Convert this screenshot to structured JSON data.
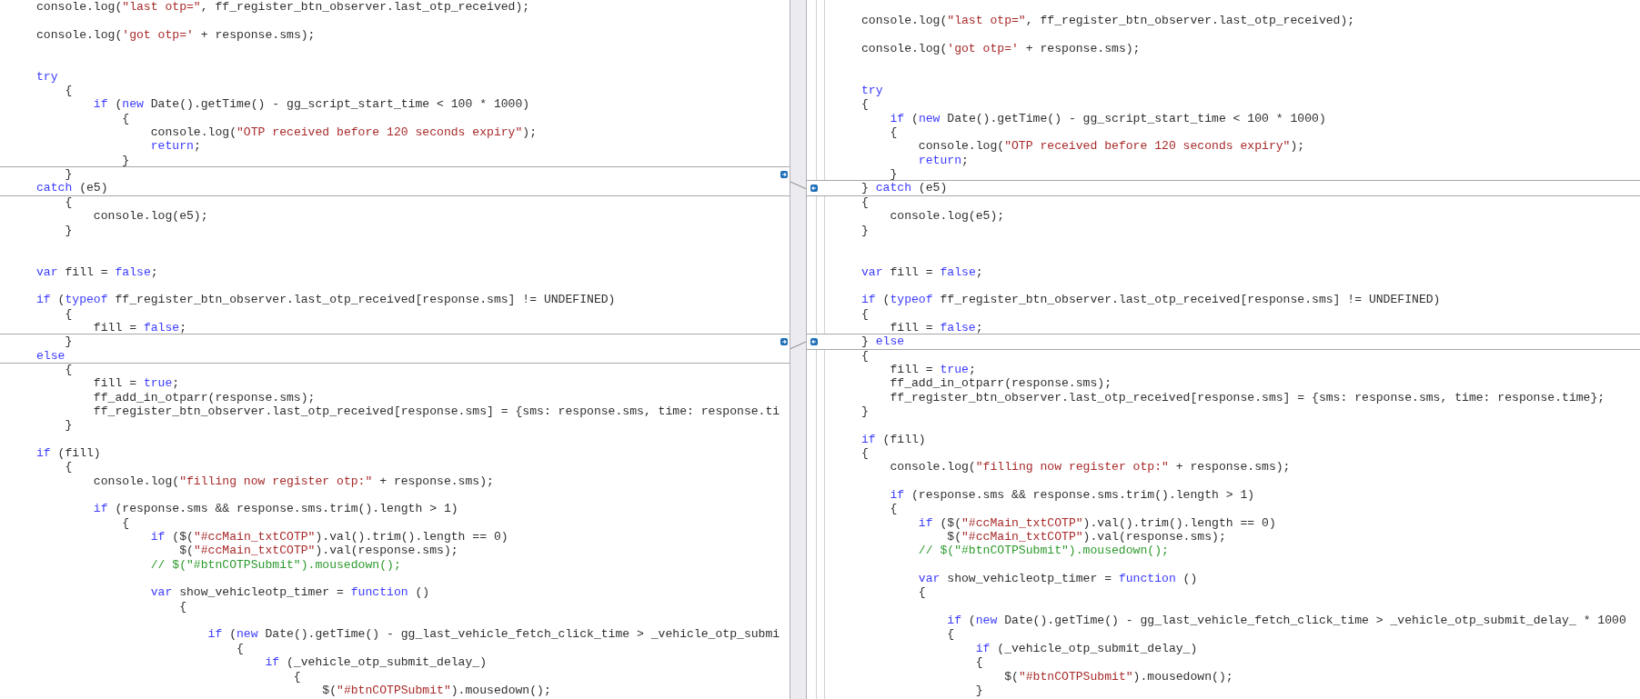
{
  "left_pane": {
    "lines": [
      {
        "kind": "code",
        "segments": [
          {
            "kind": "plain",
            "text": "console.log("
          },
          {
            "kind": "string",
            "text": "\"last otp=\""
          },
          {
            "kind": "plain",
            "text": ", ff_register_btn_observer.last_otp_received);"
          }
        ]
      },
      {
        "kind": "blank"
      },
      {
        "kind": "code",
        "segments": [
          {
            "kind": "plain",
            "text": "console.log("
          },
          {
            "kind": "string",
            "text": "'got otp='"
          },
          {
            "kind": "plain",
            "text": " + response.sms);"
          }
        ]
      },
      {
        "kind": "blank"
      },
      {
        "kind": "blank"
      },
      {
        "kind": "code",
        "segments": [
          {
            "kind": "keyword",
            "text": "try"
          }
        ]
      },
      {
        "kind": "code",
        "segments": [
          {
            "kind": "plain",
            "text": "    {"
          }
        ]
      },
      {
        "kind": "code",
        "segments": [
          {
            "kind": "keyword",
            "text": "        if"
          },
          {
            "kind": "plain",
            "text": " ("
          },
          {
            "kind": "keyword",
            "text": "new"
          },
          {
            "kind": "plain",
            "text": " Date().getTime() - gg_script_start_time < 100 * 1000)"
          }
        ]
      },
      {
        "kind": "code",
        "segments": [
          {
            "kind": "plain",
            "text": "            {"
          }
        ]
      },
      {
        "kind": "code",
        "segments": [
          {
            "kind": "plain",
            "text": "                console.log("
          },
          {
            "kind": "string",
            "text": "\"OTP received before 120 seconds expiry\""
          },
          {
            "kind": "plain",
            "text": ");"
          }
        ]
      },
      {
        "kind": "code",
        "segments": [
          {
            "kind": "keyword",
            "text": "                return"
          },
          {
            "kind": "plain",
            "text": ";"
          }
        ]
      },
      {
        "kind": "code",
        "segments": [
          {
            "kind": "plain",
            "text": "            }"
          }
        ]
      },
      {
        "kind": "change_block",
        "lines": [
          {
            "kind": "code",
            "segments": [
              {
                "kind": "plain",
                "text": "    }"
              }
            ]
          },
          {
            "kind": "code",
            "segments": [
              {
                "kind": "keyword",
                "text": "catch"
              },
              {
                "kind": "plain",
                "text": " (e5)"
              }
            ]
          }
        ]
      },
      {
        "kind": "code",
        "segments": [
          {
            "kind": "plain",
            "text": "    {"
          }
        ]
      },
      {
        "kind": "code",
        "segments": [
          {
            "kind": "plain",
            "text": "        console.log(e5);"
          }
        ]
      },
      {
        "kind": "code",
        "segments": [
          {
            "kind": "plain",
            "text": "    }"
          }
        ]
      },
      {
        "kind": "blank"
      },
      {
        "kind": "blank"
      },
      {
        "kind": "code",
        "segments": [
          {
            "kind": "keyword",
            "text": "var"
          },
          {
            "kind": "plain",
            "text": " fill = "
          },
          {
            "kind": "keyword",
            "text": "false"
          },
          {
            "kind": "plain",
            "text": ";"
          }
        ]
      },
      {
        "kind": "blank"
      },
      {
        "kind": "code",
        "segments": [
          {
            "kind": "keyword",
            "text": "if"
          },
          {
            "kind": "plain",
            "text": " ("
          },
          {
            "kind": "keyword",
            "text": "typeof"
          },
          {
            "kind": "plain",
            "text": " ff_register_btn_observer.last_otp_received[response.sms] != UNDEFINED)"
          }
        ]
      },
      {
        "kind": "code",
        "segments": [
          {
            "kind": "plain",
            "text": "    {"
          }
        ]
      },
      {
        "kind": "code",
        "segments": [
          {
            "kind": "plain",
            "text": "        fill = "
          },
          {
            "kind": "keyword",
            "text": "false"
          },
          {
            "kind": "plain",
            "text": ";"
          }
        ]
      },
      {
        "kind": "change_block",
        "lines": [
          {
            "kind": "code",
            "segments": [
              {
                "kind": "plain",
                "text": "    }"
              }
            ]
          },
          {
            "kind": "code",
            "segments": [
              {
                "kind": "keyword",
                "text": "else"
              }
            ]
          }
        ]
      },
      {
        "kind": "code",
        "segments": [
          {
            "kind": "plain",
            "text": "    {"
          }
        ]
      },
      {
        "kind": "code",
        "segments": [
          {
            "kind": "plain",
            "text": "        fill = "
          },
          {
            "kind": "keyword",
            "text": "true"
          },
          {
            "kind": "plain",
            "text": ";"
          }
        ]
      },
      {
        "kind": "code",
        "segments": [
          {
            "kind": "plain",
            "text": "        ff_add_in_otparr(response.sms);"
          }
        ]
      },
      {
        "kind": "code",
        "segments": [
          {
            "kind": "plain",
            "text": "        ff_register_btn_observer.last_otp_received[response.sms] = {sms: response.sms, time: response.ti"
          }
        ]
      },
      {
        "kind": "code",
        "segments": [
          {
            "kind": "plain",
            "text": "    }"
          }
        ]
      },
      {
        "kind": "blank"
      },
      {
        "kind": "code",
        "segments": [
          {
            "kind": "keyword",
            "text": "if"
          },
          {
            "kind": "plain",
            "text": " (fill)"
          }
        ]
      },
      {
        "kind": "code",
        "segments": [
          {
            "kind": "plain",
            "text": "    {"
          }
        ]
      },
      {
        "kind": "code",
        "segments": [
          {
            "kind": "plain",
            "text": "        console.log("
          },
          {
            "kind": "string",
            "text": "\"filling now register otp:\""
          },
          {
            "kind": "plain",
            "text": " + response.sms);"
          }
        ]
      },
      {
        "kind": "blank"
      },
      {
        "kind": "code",
        "segments": [
          {
            "kind": "keyword",
            "text": "        if"
          },
          {
            "kind": "plain",
            "text": " (response.sms && response.sms.trim().length > 1)"
          }
        ]
      },
      {
        "kind": "code",
        "segments": [
          {
            "kind": "plain",
            "text": "            {"
          }
        ]
      },
      {
        "kind": "code",
        "segments": [
          {
            "kind": "keyword",
            "text": "                if"
          },
          {
            "kind": "plain",
            "text": " ($("
          },
          {
            "kind": "string",
            "text": "\"#ccMain_txtCOTP\""
          },
          {
            "kind": "plain",
            "text": ").val().trim().length == 0)"
          }
        ]
      },
      {
        "kind": "code",
        "segments": [
          {
            "kind": "plain",
            "text": "                    $("
          },
          {
            "kind": "string",
            "text": "\"#ccMain_txtCOTP\""
          },
          {
            "kind": "plain",
            "text": ").val(response.sms);"
          }
        ]
      },
      {
        "kind": "code",
        "segments": [
          {
            "kind": "comment",
            "text": "                // $(\"#btnCOTPSubmit\").mousedown();"
          }
        ]
      },
      {
        "kind": "blank"
      },
      {
        "kind": "code",
        "segments": [
          {
            "kind": "keyword",
            "text": "                var"
          },
          {
            "kind": "plain",
            "text": " show_vehicleotp_timer = "
          },
          {
            "kind": "keyword",
            "text": "function"
          },
          {
            "kind": "plain",
            "text": " ()"
          }
        ]
      },
      {
        "kind": "code",
        "segments": [
          {
            "kind": "plain",
            "text": "                    {"
          }
        ]
      },
      {
        "kind": "blank"
      },
      {
        "kind": "code",
        "segments": [
          {
            "kind": "keyword",
            "text": "                        if"
          },
          {
            "kind": "plain",
            "text": " ("
          },
          {
            "kind": "keyword",
            "text": "new"
          },
          {
            "kind": "plain",
            "text": " Date().getTime() - gg_last_vehicle_fetch_click_time > _vehicle_otp_submi"
          }
        ]
      },
      {
        "kind": "code",
        "segments": [
          {
            "kind": "plain",
            "text": "                            {"
          }
        ]
      },
      {
        "kind": "code",
        "segments": [
          {
            "kind": "keyword",
            "text": "                                if"
          },
          {
            "kind": "plain",
            "text": " (_vehicle_otp_submit_delay_)"
          }
        ]
      },
      {
        "kind": "code",
        "segments": [
          {
            "kind": "plain",
            "text": "                                    {"
          }
        ]
      },
      {
        "kind": "code",
        "segments": [
          {
            "kind": "plain",
            "text": "                                        $("
          },
          {
            "kind": "string",
            "text": "\"#btnCOTPSubmit\""
          },
          {
            "kind": "plain",
            "text": ").mousedown();"
          }
        ]
      }
    ]
  },
  "right_pane": {
    "lines": [
      {
        "kind": "blank"
      },
      {
        "kind": "code",
        "segments": [
          {
            "kind": "plain",
            "text": "console.log("
          },
          {
            "kind": "string",
            "text": "\"last otp=\""
          },
          {
            "kind": "plain",
            "text": ", ff_register_btn_observer.last_otp_received);"
          }
        ]
      },
      {
        "kind": "blank"
      },
      {
        "kind": "code",
        "segments": [
          {
            "kind": "plain",
            "text": "console.log("
          },
          {
            "kind": "string",
            "text": "'got otp='"
          },
          {
            "kind": "plain",
            "text": " + response.sms);"
          }
        ]
      },
      {
        "kind": "blank"
      },
      {
        "kind": "blank"
      },
      {
        "kind": "code",
        "segments": [
          {
            "kind": "keyword",
            "text": "try"
          }
        ]
      },
      {
        "kind": "code",
        "segments": [
          {
            "kind": "plain",
            "text": "{"
          }
        ]
      },
      {
        "kind": "code",
        "segments": [
          {
            "kind": "keyword",
            "text": "    if"
          },
          {
            "kind": "plain",
            "text": " ("
          },
          {
            "kind": "keyword",
            "text": "new"
          },
          {
            "kind": "plain",
            "text": " Date().getTime() - gg_script_start_time < 100 * 1000)"
          }
        ]
      },
      {
        "kind": "code",
        "segments": [
          {
            "kind": "plain",
            "text": "    {"
          }
        ]
      },
      {
        "kind": "code",
        "segments": [
          {
            "kind": "plain",
            "text": "        console.log("
          },
          {
            "kind": "string",
            "text": "\"OTP received before 120 seconds expiry\""
          },
          {
            "kind": "plain",
            "text": ");"
          }
        ]
      },
      {
        "kind": "code",
        "segments": [
          {
            "kind": "keyword",
            "text": "        return"
          },
          {
            "kind": "plain",
            "text": ";"
          }
        ]
      },
      {
        "kind": "code",
        "segments": [
          {
            "kind": "plain",
            "text": "    }"
          }
        ]
      },
      {
        "kind": "change_block",
        "lines": [
          {
            "kind": "code",
            "segments": [
              {
                "kind": "plain",
                "text": "} "
              },
              {
                "kind": "keyword",
                "text": "catch"
              },
              {
                "kind": "plain",
                "text": " (e5)"
              }
            ]
          }
        ]
      },
      {
        "kind": "code",
        "segments": [
          {
            "kind": "plain",
            "text": "{"
          }
        ]
      },
      {
        "kind": "code",
        "segments": [
          {
            "kind": "plain",
            "text": "    console.log(e5);"
          }
        ]
      },
      {
        "kind": "code",
        "segments": [
          {
            "kind": "plain",
            "text": "}"
          }
        ]
      },
      {
        "kind": "blank"
      },
      {
        "kind": "blank"
      },
      {
        "kind": "code",
        "segments": [
          {
            "kind": "keyword",
            "text": "var"
          },
          {
            "kind": "plain",
            "text": " fill = "
          },
          {
            "kind": "keyword",
            "text": "false"
          },
          {
            "kind": "plain",
            "text": ";"
          }
        ]
      },
      {
        "kind": "blank"
      },
      {
        "kind": "code",
        "segments": [
          {
            "kind": "keyword",
            "text": "if"
          },
          {
            "kind": "plain",
            "text": " ("
          },
          {
            "kind": "keyword",
            "text": "typeof"
          },
          {
            "kind": "plain",
            "text": " ff_register_btn_observer.last_otp_received[response.sms] != UNDEFINED)"
          }
        ]
      },
      {
        "kind": "code",
        "segments": [
          {
            "kind": "plain",
            "text": "{"
          }
        ]
      },
      {
        "kind": "code",
        "segments": [
          {
            "kind": "plain",
            "text": "    fill = "
          },
          {
            "kind": "keyword",
            "text": "false"
          },
          {
            "kind": "plain",
            "text": ";"
          }
        ]
      },
      {
        "kind": "change_block",
        "lines": [
          {
            "kind": "code",
            "segments": [
              {
                "kind": "plain",
                "text": "} "
              },
              {
                "kind": "keyword",
                "text": "else"
              }
            ]
          }
        ]
      },
      {
        "kind": "code",
        "segments": [
          {
            "kind": "plain",
            "text": "{"
          }
        ]
      },
      {
        "kind": "code",
        "segments": [
          {
            "kind": "plain",
            "text": "    fill = "
          },
          {
            "kind": "keyword",
            "text": "true"
          },
          {
            "kind": "plain",
            "text": ";"
          }
        ]
      },
      {
        "kind": "code",
        "segments": [
          {
            "kind": "plain",
            "text": "    ff_add_in_otparr(response.sms);"
          }
        ]
      },
      {
        "kind": "code",
        "segments": [
          {
            "kind": "plain",
            "text": "    ff_register_btn_observer.last_otp_received[response.sms] = {sms: response.sms, time: response.time};"
          }
        ]
      },
      {
        "kind": "code",
        "segments": [
          {
            "kind": "plain",
            "text": "}"
          }
        ]
      },
      {
        "kind": "blank"
      },
      {
        "kind": "code",
        "segments": [
          {
            "kind": "keyword",
            "text": "if"
          },
          {
            "kind": "plain",
            "text": " (fill)"
          }
        ]
      },
      {
        "kind": "code",
        "segments": [
          {
            "kind": "plain",
            "text": "{"
          }
        ]
      },
      {
        "kind": "code",
        "segments": [
          {
            "kind": "plain",
            "text": "    console.log("
          },
          {
            "kind": "string",
            "text": "\"filling now register otp:\""
          },
          {
            "kind": "plain",
            "text": " + response.sms);"
          }
        ]
      },
      {
        "kind": "blank"
      },
      {
        "kind": "code",
        "segments": [
          {
            "kind": "keyword",
            "text": "    if"
          },
          {
            "kind": "plain",
            "text": " (response.sms && response.sms.trim().length > 1)"
          }
        ]
      },
      {
        "kind": "code",
        "segments": [
          {
            "kind": "plain",
            "text": "    {"
          }
        ]
      },
      {
        "kind": "code",
        "segments": [
          {
            "kind": "keyword",
            "text": "        if"
          },
          {
            "kind": "plain",
            "text": " ($("
          },
          {
            "kind": "string",
            "text": "\"#ccMain_txtCOTP\""
          },
          {
            "kind": "plain",
            "text": ").val().trim().length == 0)"
          }
        ]
      },
      {
        "kind": "code",
        "segments": [
          {
            "kind": "plain",
            "text": "            $("
          },
          {
            "kind": "string",
            "text": "\"#ccMain_txtCOTP\""
          },
          {
            "kind": "plain",
            "text": ").val(response.sms);"
          }
        ]
      },
      {
        "kind": "code",
        "segments": [
          {
            "kind": "comment",
            "text": "        // $(\"#btnCOTPSubmit\").mousedown();"
          }
        ]
      },
      {
        "kind": "blank"
      },
      {
        "kind": "code",
        "segments": [
          {
            "kind": "keyword",
            "text": "        var"
          },
          {
            "kind": "plain",
            "text": " show_vehicleotp_timer = "
          },
          {
            "kind": "keyword",
            "text": "function"
          },
          {
            "kind": "plain",
            "text": " ()"
          }
        ]
      },
      {
        "kind": "code",
        "segments": [
          {
            "kind": "plain",
            "text": "        {"
          }
        ]
      },
      {
        "kind": "blank"
      },
      {
        "kind": "code",
        "segments": [
          {
            "kind": "keyword",
            "text": "            if"
          },
          {
            "kind": "plain",
            "text": " ("
          },
          {
            "kind": "keyword",
            "text": "new"
          },
          {
            "kind": "plain",
            "text": " Date().getTime() - gg_last_vehicle_fetch_click_time > _vehicle_otp_submit_delay_ * 1000"
          }
        ]
      },
      {
        "kind": "code",
        "segments": [
          {
            "kind": "plain",
            "text": "            {"
          }
        ]
      },
      {
        "kind": "code",
        "segments": [
          {
            "kind": "keyword",
            "text": "                if"
          },
          {
            "kind": "plain",
            "text": " (_vehicle_otp_submit_delay_)"
          }
        ]
      },
      {
        "kind": "code",
        "segments": [
          {
            "kind": "plain",
            "text": "                {"
          }
        ]
      },
      {
        "kind": "code",
        "segments": [
          {
            "kind": "plain",
            "text": "                    $("
          },
          {
            "kind": "string",
            "text": "\"#btnCOTPSubmit\""
          },
          {
            "kind": "plain",
            "text": ").mousedown();"
          }
        ]
      },
      {
        "kind": "code",
        "segments": [
          {
            "kind": "plain",
            "text": "                }"
          }
        ]
      }
    ]
  }
}
